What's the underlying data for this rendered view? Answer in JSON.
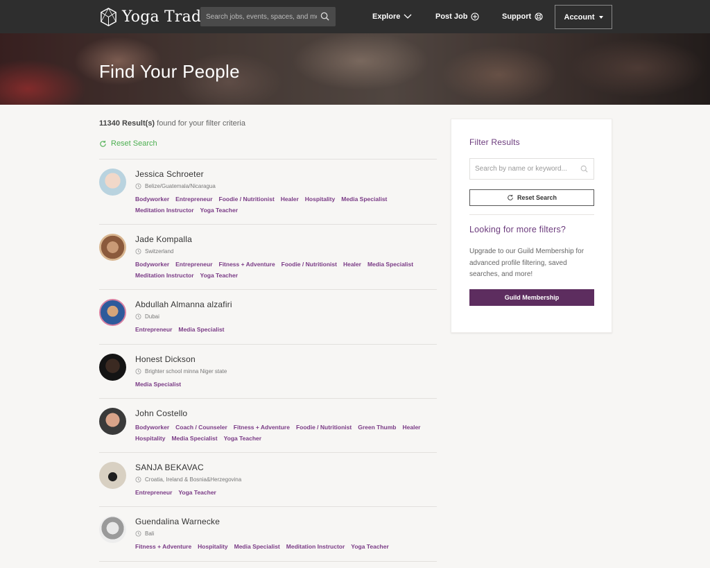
{
  "header": {
    "logo_text": "Yoga Trade",
    "search_placeholder": "Search jobs, events, spaces, and more...",
    "nav": {
      "explore": "Explore",
      "post_job": "Post Job",
      "support": "Support",
      "account": "Account"
    }
  },
  "hero": {
    "title": "Find Your People"
  },
  "results": {
    "count": "11340 Result(s)",
    "count_suffix": "found for your filter criteria",
    "reset_label": "Reset Search"
  },
  "people": [
    {
      "name": "Jessica Schroeter",
      "location": "Belize/Guatemala/Nicaragua",
      "tags": [
        "Bodyworker",
        "Entrepreneur",
        "Foodie / Nutritionist",
        "Healer",
        "Hospitality",
        "Media Specialist",
        "Meditation Instructor",
        "Yoga Teacher"
      ]
    },
    {
      "name": "Jade Kompalla",
      "location": "Switzerland",
      "tags": [
        "Bodyworker",
        "Entrepreneur",
        "Fitness + Adventure",
        "Foodie / Nutritionist",
        "Healer",
        "Media Specialist",
        "Meditation Instructor",
        "Yoga Teacher"
      ]
    },
    {
      "name": "Abdullah Almanna alzafiri",
      "location": "Dubai",
      "tags": [
        "Entrepreneur",
        "Media Specialist"
      ]
    },
    {
      "name": "Honest Dickson",
      "location": "Brighter school minna Niger state",
      "tags": [
        "Media Specialist"
      ]
    },
    {
      "name": "John Costello",
      "location": "",
      "tags": [
        "Bodyworker",
        "Coach / Counseler",
        "Fitness + Adventure",
        "Foodie / Nutritionist",
        "Green Thumb",
        "Healer",
        "Hospitality",
        "Media Specialist",
        "Yoga Teacher"
      ]
    },
    {
      "name": "SANJA BEKAVAC",
      "location": "Croatia, Ireland & Bosnia&Herzegovina",
      "tags": [
        "Entrepreneur",
        "Yoga Teacher"
      ]
    },
    {
      "name": "Guendalina Warnecke",
      "location": "Bali",
      "tags": [
        "Fitness + Adventure",
        "Hospitality",
        "Media Specialist",
        "Meditation Instructor",
        "Yoga Teacher"
      ]
    }
  ],
  "sidebar": {
    "title": "Filter Results",
    "search_placeholder": "Search by name or keyword...",
    "reset_label": "Reset Search",
    "more_title": "Looking for more filters?",
    "upgrade_text": "Upgrade to our Guild Membership for advanced profile filtering, saved searches, and more!",
    "guild_button": "Guild Membership"
  },
  "colors": {
    "header_bg": "#2e2e2e",
    "accent_purple": "#7a3b86",
    "button_purple": "#5d2d5f",
    "reset_green": "#4caf50"
  }
}
